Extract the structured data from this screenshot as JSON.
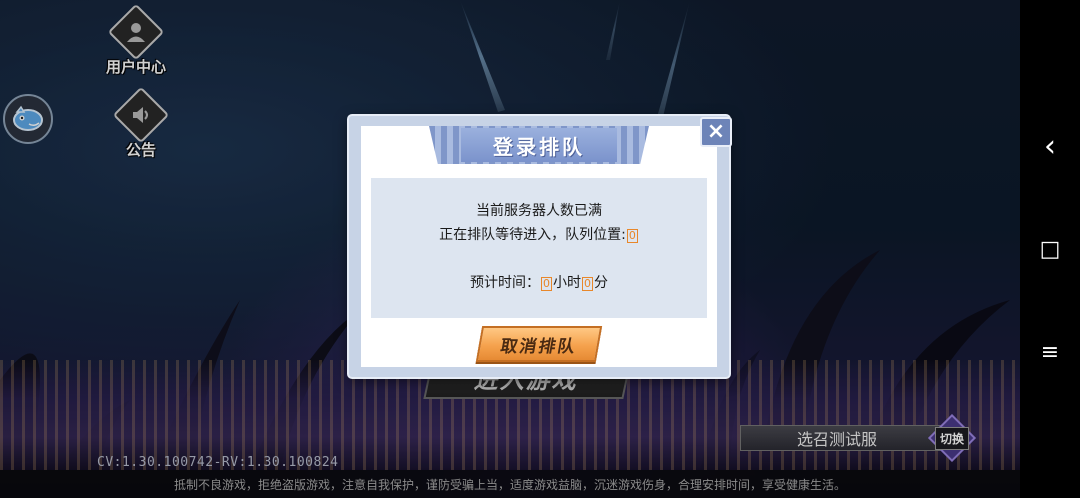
{
  "sidebar": {
    "user_center_label": "用户中心",
    "notice_label": "公告"
  },
  "main": {
    "enter_game_label": "进入游戏",
    "server_name": "选召测试服",
    "switch_label": "切换",
    "version_text": "CV:1.30.100742-RV:1.30.100824"
  },
  "footer": {
    "notice": "抵制不良游戏，拒绝盗版游戏，注意自我保护，谨防受骗上当，适度游戏益脑，沉迷游戏伤身，合理安排时间，享受健康生活。"
  },
  "dialog": {
    "title": "登录排队",
    "close_icon": "×",
    "line1": "当前服务器人数已满",
    "line2_prefix": "正在排队等待进入，队列位置:",
    "queue_position": "0",
    "line3_prefix": "预计时间：",
    "hours": "0",
    "hours_unit": "小时",
    "minutes": "0",
    "minutes_unit": "分",
    "cancel_label": "取消排队"
  },
  "system_nav": {
    "back_icon": "‹",
    "home_icon": "□",
    "menu_icon": "≡"
  },
  "colors": {
    "dialog_title_bg": "#7b93cc",
    "cancel_button": "#f5a24d",
    "value_highlight": "#e8872a"
  }
}
